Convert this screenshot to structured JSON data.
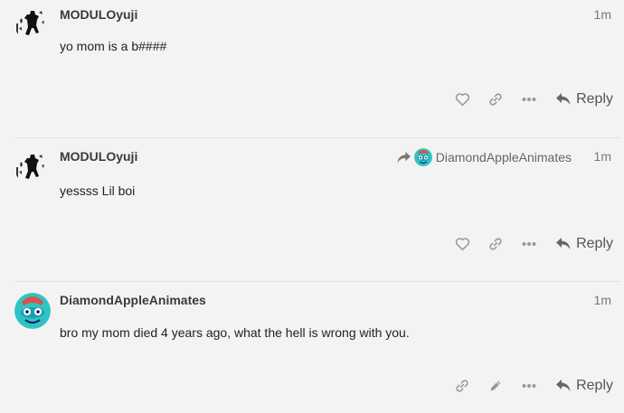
{
  "posts": [
    {
      "username": "MODULOyuji",
      "time": "1m",
      "body": "yo mom is a b####",
      "reply_to": null,
      "reply_label": "Reply",
      "avatar_icon": "ninja-figure-avatar"
    },
    {
      "username": "MODULOyuji",
      "time": "1m",
      "body": "yessss Lil boi",
      "reply_to": "DiamondAppleAnimates",
      "reply_label": "Reply",
      "avatar_icon": "ninja-figure-avatar"
    },
    {
      "username": "DiamondAppleAnimates",
      "time": "1m",
      "body": "bro my mom died 4 years ago, what the hell is wrong with you.",
      "reply_to": null,
      "reply_label": "Reply",
      "avatar_icon": "teal-monster-avatar"
    }
  ],
  "colors": {
    "background": "#f3f3f3",
    "icon": "#999999",
    "reply_text": "#555555",
    "divider": "#e1e1e1",
    "avatar_teal": "#2ec4c4"
  }
}
